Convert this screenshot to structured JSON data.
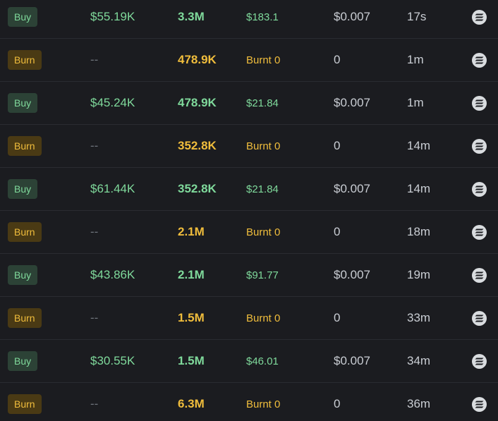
{
  "rows": [
    {
      "type": "Buy",
      "kind": "buy",
      "usd": "$55.19K",
      "amount": "3.3M",
      "sol": "$183.1",
      "price": "$0.007",
      "age": "17s",
      "icon": "solana-icon"
    },
    {
      "type": "Burn",
      "kind": "burn",
      "usd": "--",
      "amount": "478.9K",
      "sol": "Burnt 0",
      "price": "0",
      "age": "1m",
      "icon": "solana-icon"
    },
    {
      "type": "Buy",
      "kind": "buy",
      "usd": "$45.24K",
      "amount": "478.9K",
      "sol": "$21.84",
      "price": "$0.007",
      "age": "1m",
      "icon": "solana-icon"
    },
    {
      "type": "Burn",
      "kind": "burn",
      "usd": "--",
      "amount": "352.8K",
      "sol": "Burnt 0",
      "price": "0",
      "age": "14m",
      "icon": "solana-icon"
    },
    {
      "type": "Buy",
      "kind": "buy",
      "usd": "$61.44K",
      "amount": "352.8K",
      "sol": "$21.84",
      "price": "$0.007",
      "age": "14m",
      "icon": "solana-icon"
    },
    {
      "type": "Burn",
      "kind": "burn",
      "usd": "--",
      "amount": "2.1M",
      "sol": "Burnt 0",
      "price": "0",
      "age": "18m",
      "icon": "solana-icon"
    },
    {
      "type": "Buy",
      "kind": "buy",
      "usd": "$43.86K",
      "amount": "2.1M",
      "sol": "$91.77",
      "price": "$0.007",
      "age": "19m",
      "icon": "solana-icon"
    },
    {
      "type": "Burn",
      "kind": "burn",
      "usd": "--",
      "amount": "1.5M",
      "sol": "Burnt 0",
      "price": "0",
      "age": "33m",
      "icon": "solana-icon"
    },
    {
      "type": "Buy",
      "kind": "buy",
      "usd": "$30.55K",
      "amount": "1.5M",
      "sol": "$46.01",
      "price": "$0.007",
      "age": "34m",
      "icon": "solana-icon"
    },
    {
      "type": "Burn",
      "kind": "burn",
      "usd": "--",
      "amount": "6.3M",
      "sol": "Burnt 0",
      "price": "0",
      "age": "36m",
      "icon": "solana-icon"
    }
  ],
  "colors": {
    "background": "#1b1c20",
    "buy": "#7fd99b",
    "burn": "#f0bd3c",
    "muted": "#c9cdd3"
  }
}
